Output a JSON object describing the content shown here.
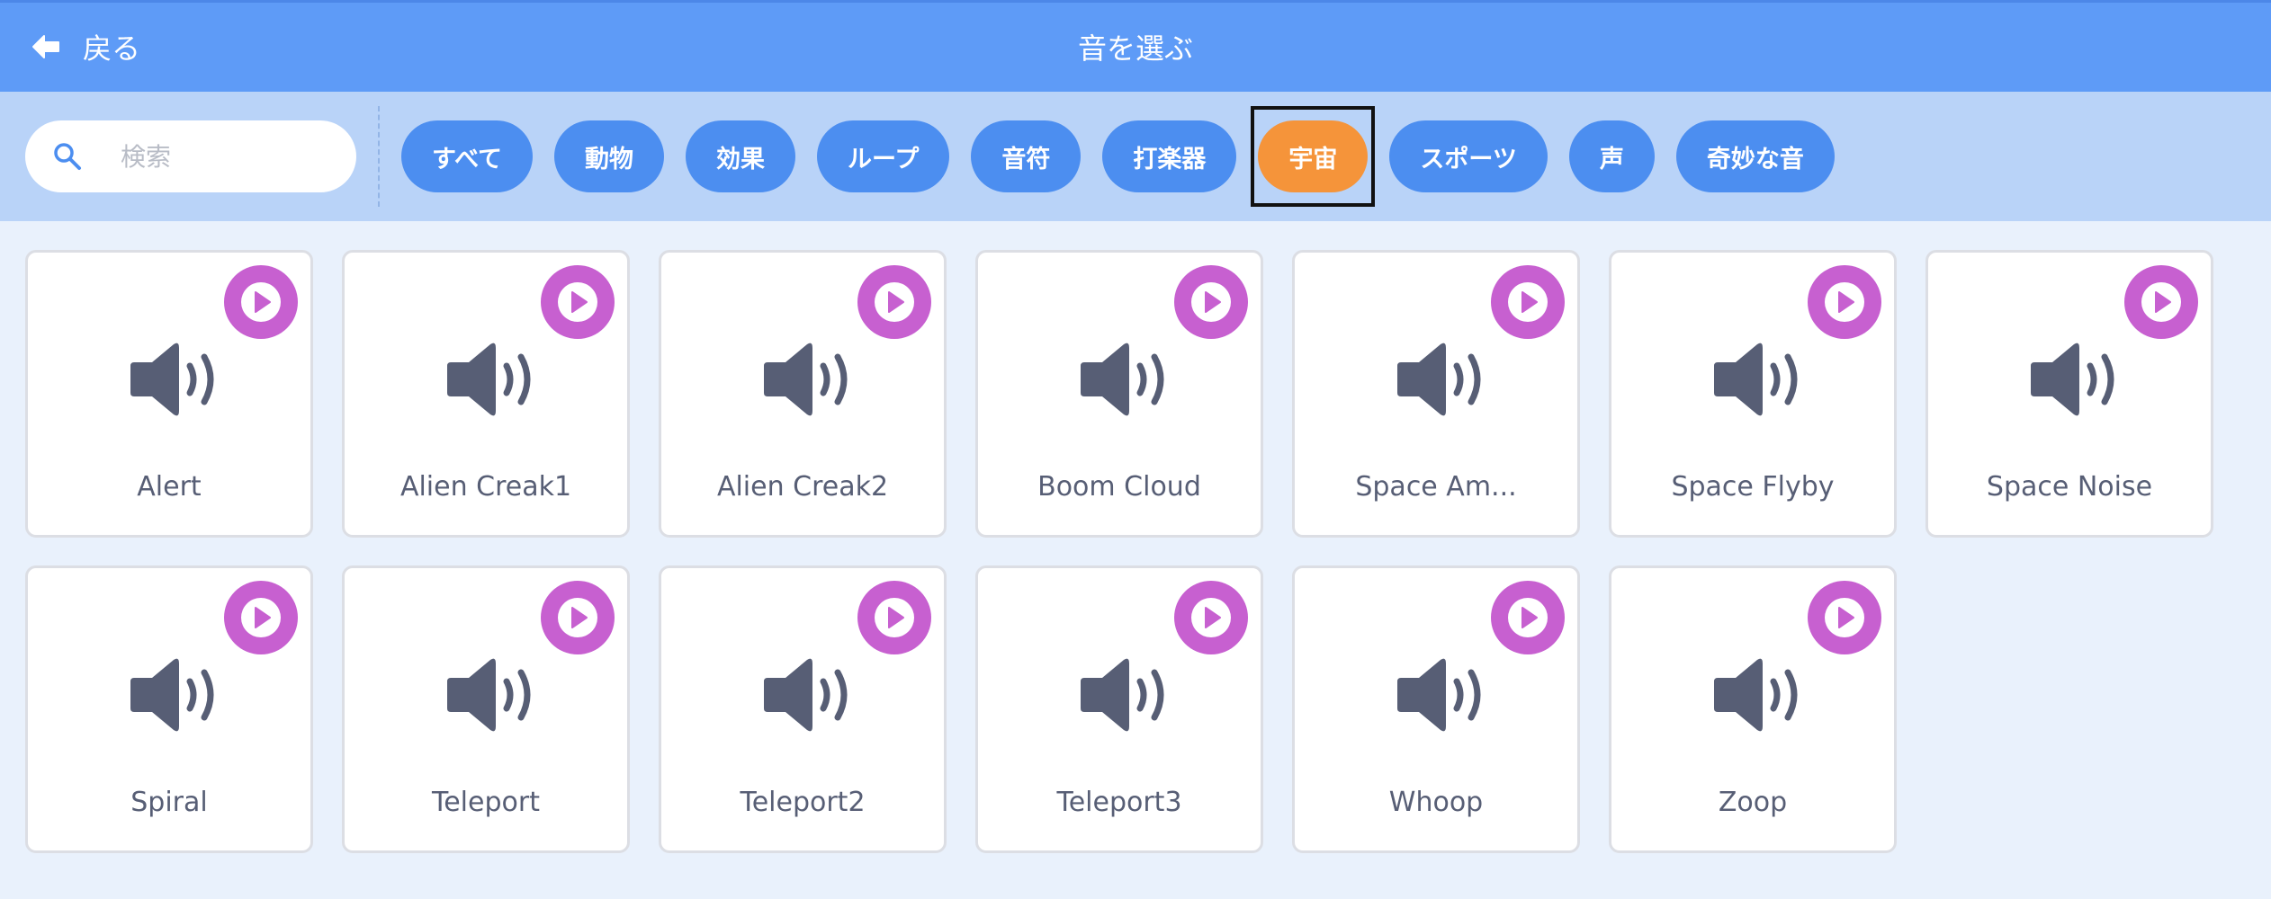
{
  "header": {
    "back_label": "戻る",
    "title": "音を選ぶ"
  },
  "search": {
    "placeholder": "検索",
    "value": ""
  },
  "tags": [
    {
      "label": "すべて",
      "active": false
    },
    {
      "label": "動物",
      "active": false
    },
    {
      "label": "効果",
      "active": false
    },
    {
      "label": "ループ",
      "active": false
    },
    {
      "label": "音符",
      "active": false
    },
    {
      "label": "打楽器",
      "active": false
    },
    {
      "label": "宇宙",
      "active": true
    },
    {
      "label": "スポーツ",
      "active": false
    },
    {
      "label": "声",
      "active": false
    },
    {
      "label": "奇妙な音",
      "active": false
    }
  ],
  "sounds": [
    {
      "name": "Alert"
    },
    {
      "name": "Alien Creak1"
    },
    {
      "name": "Alien Creak2"
    },
    {
      "name": "Boom Cloud"
    },
    {
      "name": "Space Am..."
    },
    {
      "name": "Space Flyby"
    },
    {
      "name": "Space Noise"
    },
    {
      "name": "Spiral"
    },
    {
      "name": "Teleport"
    },
    {
      "name": "Teleport2"
    },
    {
      "name": "Teleport3"
    },
    {
      "name": "Whoop"
    },
    {
      "name": "Zoop"
    }
  ],
  "icons": {
    "back": "arrow-left-icon",
    "search": "search-icon",
    "sound": "speaker-icon",
    "play": "play-icon"
  },
  "colors": {
    "header": "#5e9bf7",
    "filterbar": "#b9d3f8",
    "tag": "#4c8ef0",
    "tag_active": "#f5943a",
    "play_button": "#c760d0",
    "speaker": "#575e75",
    "background": "#e9f1fc"
  }
}
